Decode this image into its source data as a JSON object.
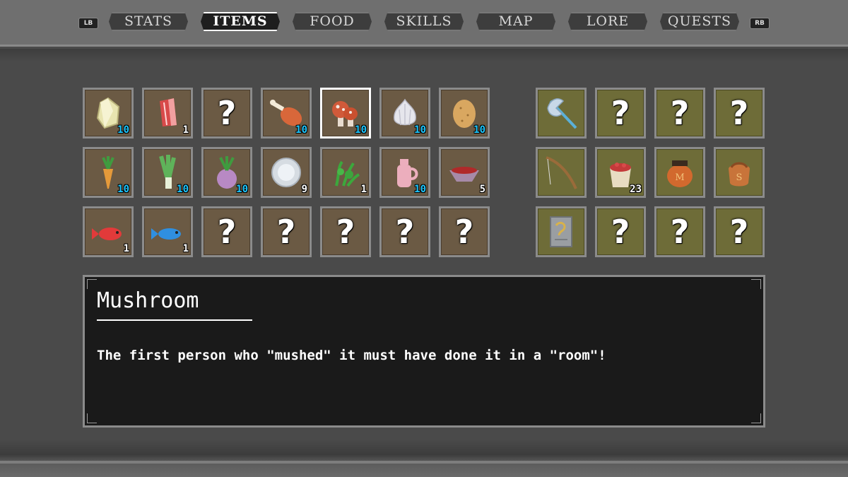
{
  "bumpers": {
    "left": "LB",
    "right": "RB"
  },
  "tabs": [
    {
      "label": "STATS",
      "active": false
    },
    {
      "label": "ITEMS",
      "active": true
    },
    {
      "label": "FOOD",
      "active": false
    },
    {
      "label": "SKILLS",
      "active": false
    },
    {
      "label": "MAP",
      "active": false
    },
    {
      "label": "LORE",
      "active": false
    },
    {
      "label": "QUESTS",
      "active": false
    }
  ],
  "food_grid": [
    [
      {
        "icon": "crystal-icon",
        "count": "10",
        "count_color": "#1ec8ff"
      },
      {
        "icon": "raw-meat-icon",
        "count": "1",
        "count_color": "#ffffff"
      },
      {
        "icon": "unknown",
        "count": "",
        "label": "?"
      },
      {
        "icon": "drumstick-icon",
        "count": "10",
        "count_color": "#1ec8ff"
      },
      {
        "icon": "mushroom-icon",
        "count": "10",
        "count_color": "#1ec8ff",
        "selected": true
      },
      {
        "icon": "garlic-icon",
        "count": "10",
        "count_color": "#1ec8ff"
      },
      {
        "icon": "potato-icon",
        "count": "10",
        "count_color": "#1ec8ff"
      }
    ],
    [
      {
        "icon": "carrot-icon",
        "count": "10",
        "count_color": "#1ec8ff"
      },
      {
        "icon": "leek-icon",
        "count": "10",
        "count_color": "#1ec8ff"
      },
      {
        "icon": "turnip-icon",
        "count": "10",
        "count_color": "#1ec8ff"
      },
      {
        "icon": "plate-icon",
        "count": "9",
        "count_color": "#ffffff"
      },
      {
        "icon": "herb-icon",
        "count": "1",
        "count_color": "#ffffff"
      },
      {
        "icon": "jug-icon",
        "count": "10",
        "count_color": "#1ec8ff"
      },
      {
        "icon": "berry-bowl-icon",
        "count": "5",
        "count_color": "#ffffff"
      }
    ],
    [
      {
        "icon": "red-fish-icon",
        "count": "1",
        "count_color": "#ffffff"
      },
      {
        "icon": "blue-fish-icon",
        "count": "1",
        "count_color": "#ffffff"
      },
      {
        "icon": "unknown",
        "count": "",
        "label": "?"
      },
      {
        "icon": "unknown",
        "count": "",
        "label": "?"
      },
      {
        "icon": "unknown",
        "count": "",
        "label": "?"
      },
      {
        "icon": "unknown",
        "count": "",
        "label": "?"
      },
      {
        "icon": "unknown",
        "count": "",
        "label": "?"
      }
    ]
  ],
  "tool_grid": [
    [
      {
        "icon": "double-axe-icon",
        "count": ""
      },
      {
        "icon": "unknown",
        "count": "",
        "label": "?"
      },
      {
        "icon": "unknown",
        "count": "",
        "label": "?"
      },
      {
        "icon": "unknown",
        "count": "",
        "label": "?"
      }
    ],
    [
      {
        "icon": "fishing-rod-icon",
        "count": ""
      },
      {
        "icon": "berry-bucket-icon",
        "count": "23",
        "count_color": "#ffffff"
      },
      {
        "icon": "pot-m-icon",
        "count": ""
      },
      {
        "icon": "pouch-s-icon",
        "count": ""
      }
    ],
    [
      {
        "icon": "scroll-icon",
        "count": ""
      },
      {
        "icon": "unknown",
        "count": "",
        "label": "?"
      },
      {
        "icon": "unknown",
        "count": "",
        "label": "?"
      },
      {
        "icon": "unknown",
        "count": "",
        "label": "?"
      }
    ]
  ],
  "pot_letter": "M",
  "pouch_letter": "S",
  "description": {
    "title": "Mushroom",
    "text": "The first person who \"mushed\" it must have done it in a \"room\"!"
  },
  "colors": {
    "food_slot": "#6b5a44",
    "tool_slot": "#6e6c38",
    "count_max": "#1ec8ff",
    "selected_border": "#ffffff"
  }
}
